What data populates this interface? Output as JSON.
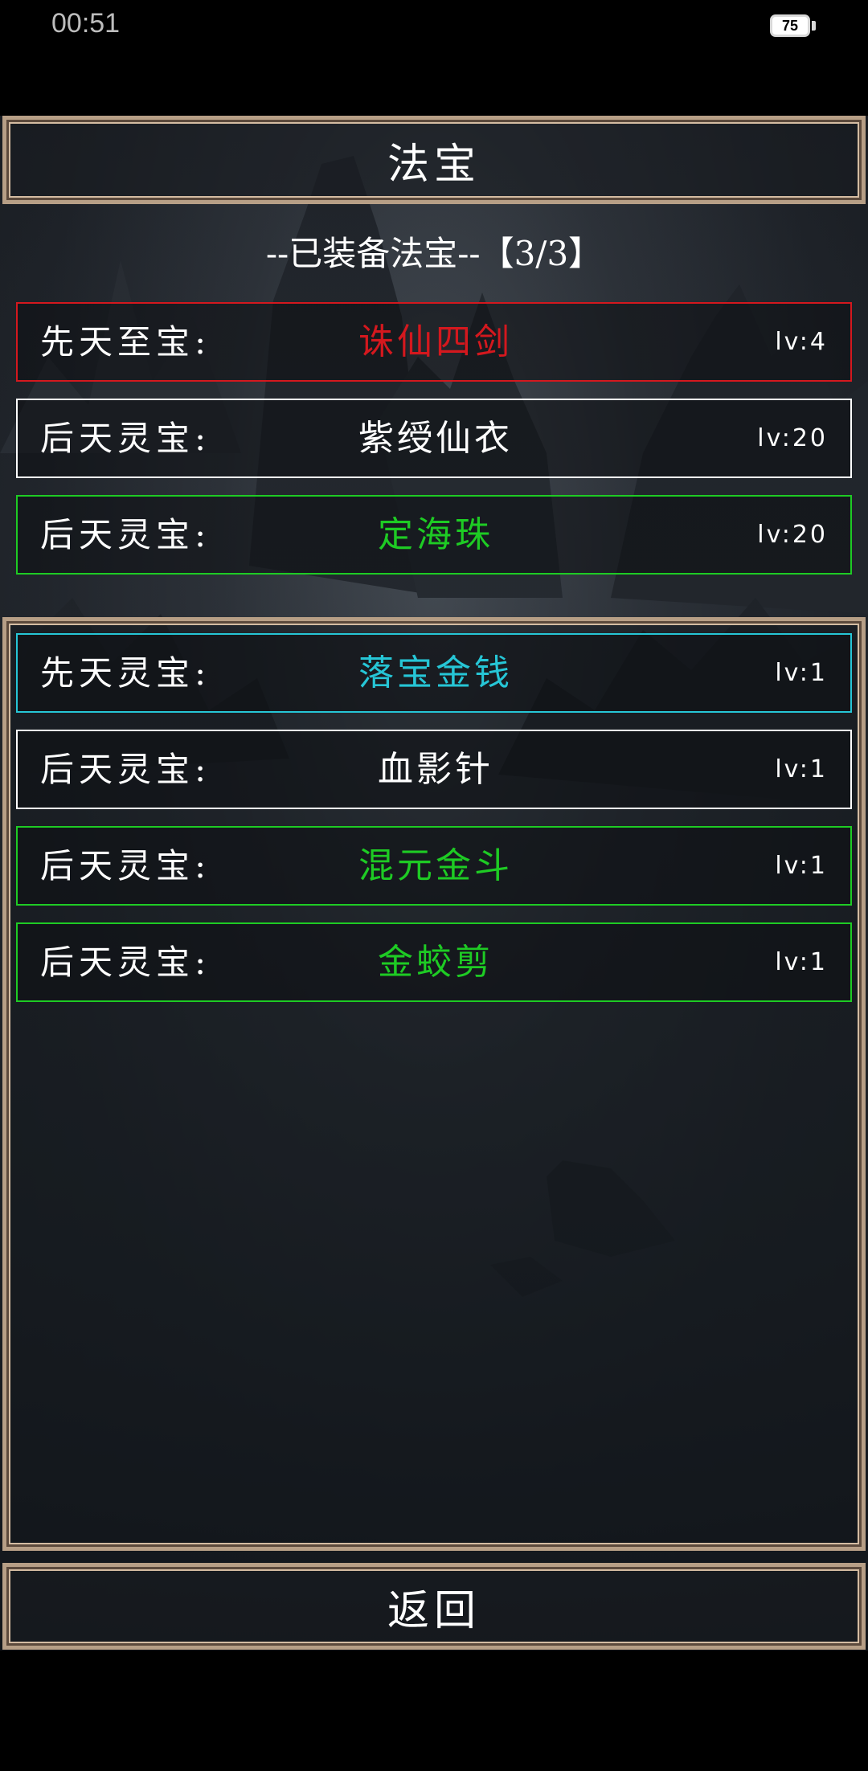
{
  "status_bar": {
    "time": "00:51",
    "battery": "75"
  },
  "title": "法宝",
  "equipped_header": "--已装备法宝--【3/3】",
  "equipped": [
    {
      "rank": "先天至宝:",
      "name": "诛仙四剑",
      "level": "lv:4",
      "color": "#d4181e"
    },
    {
      "rank": "后天灵宝:",
      "name": "紫绶仙衣",
      "level": "lv:20",
      "color": "#ffffff"
    },
    {
      "rank": "后天灵宝:",
      "name": "定海珠",
      "level": "lv:20",
      "color": "#1ecb24"
    }
  ],
  "inventory": [
    {
      "rank": "先天灵宝:",
      "name": "落宝金钱",
      "level": "lv:1",
      "color": "#26c6d6"
    },
    {
      "rank": "后天灵宝:",
      "name": "血影针",
      "level": "lv:1",
      "color": "#ffffff"
    },
    {
      "rank": "后天灵宝:",
      "name": "混元金斗",
      "level": "lv:1",
      "color": "#1ecb24"
    },
    {
      "rank": "后天灵宝:",
      "name": "金蛟剪",
      "level": "lv:1",
      "color": "#1ecb24"
    }
  ],
  "back_label": "返回"
}
